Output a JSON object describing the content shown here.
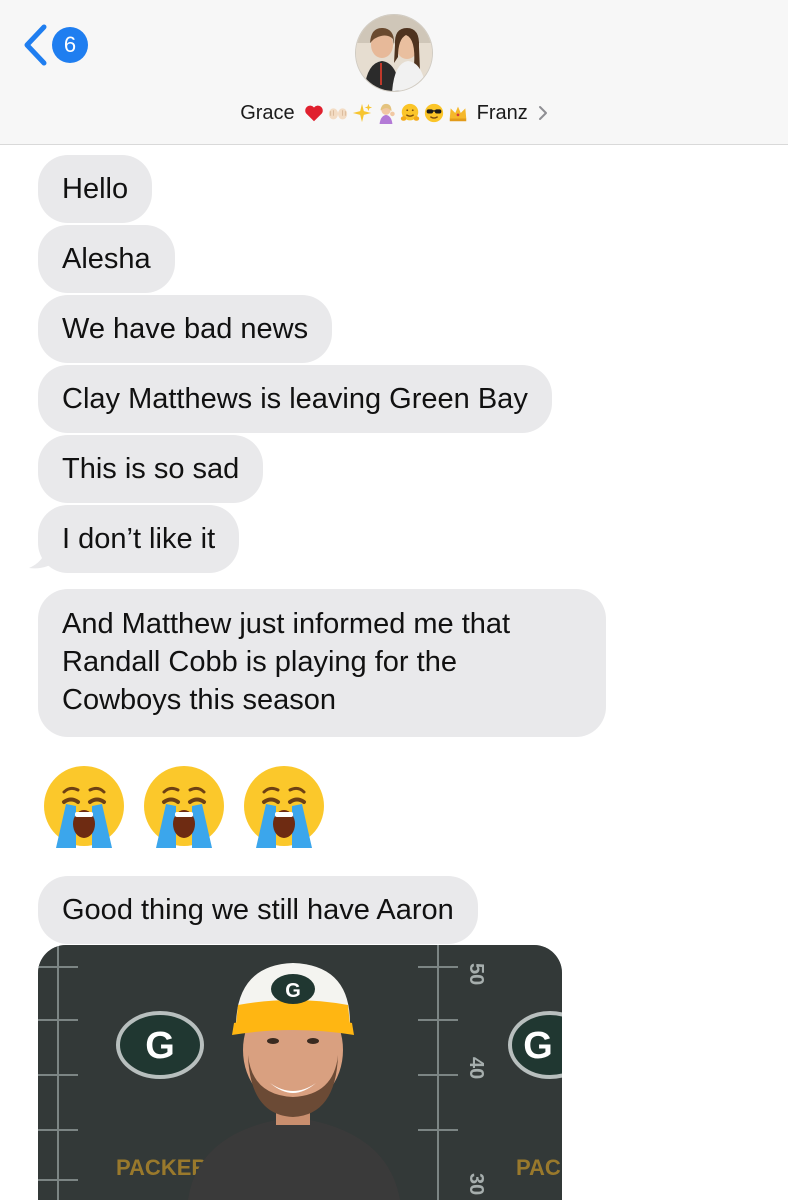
{
  "header": {
    "back_count": "6",
    "contact_first": "Grace",
    "contact_last": "Franz",
    "emoji_icons": [
      "red-heart-icon",
      "open-hands-icon",
      "sparkles-icon",
      "person-tipping-hand-icon",
      "hugging-face-icon",
      "sunglasses-face-icon",
      "crown-icon"
    ]
  },
  "messages": [
    {
      "text": "Hello"
    },
    {
      "text": "Alesha"
    },
    {
      "text": "We have bad news"
    },
    {
      "text": "Clay Matthews is leaving Green Bay"
    },
    {
      "text": "This is so sad"
    },
    {
      "text": "I don’t like it"
    },
    {
      "line1": "And Matthew just informed me that",
      "line2": "Randall Cobb is playing for the",
      "line3": "Cowboys this season"
    },
    {
      "emojis": [
        "crying-face-icon",
        "crying-face-icon",
        "crying-face-icon"
      ]
    },
    {
      "text": "Good thing we still have Aaron"
    }
  ],
  "gif": {
    "backdrop_text": {
      "packers_left": "PACKERS",
      "packers_right": "PAC",
      "yard_50": "50",
      "yard_40": "40",
      "yard_30": "30"
    }
  },
  "colors": {
    "accent": "#1f7ef0",
    "bubble": "#e9e9eb",
    "header_bg": "#f7f7f7",
    "packers_green": "#203731",
    "packers_gold": "#ffb612"
  }
}
